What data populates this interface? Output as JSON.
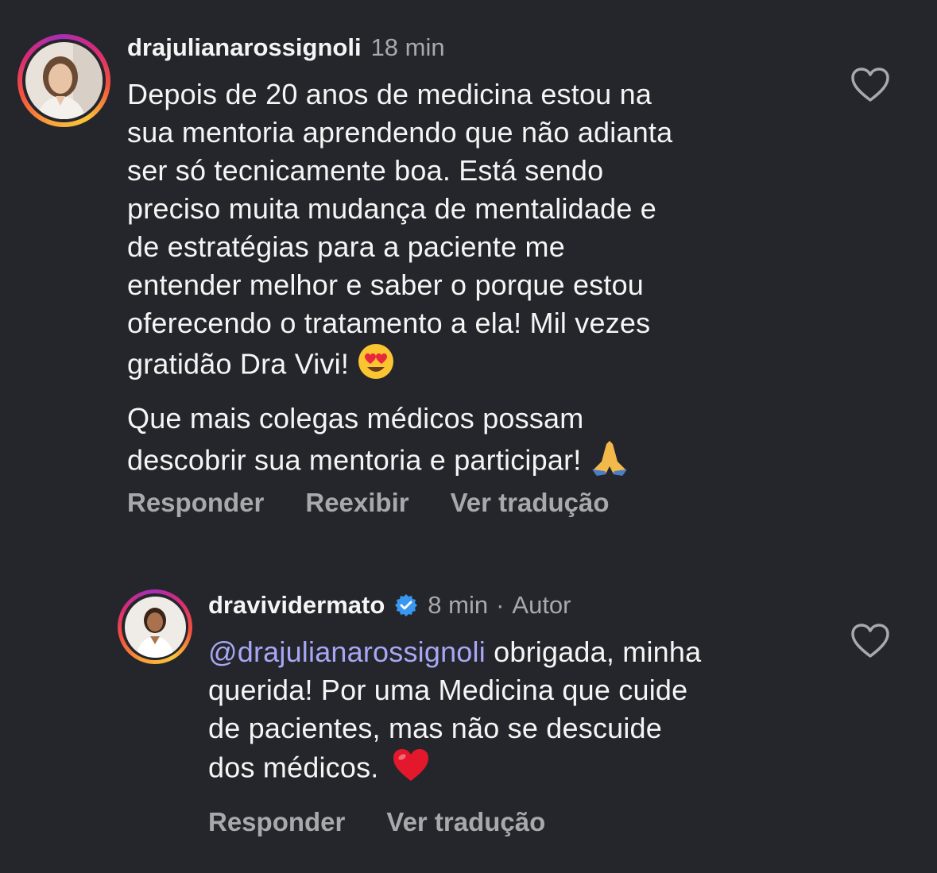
{
  "comments": [
    {
      "username": "drajulianarossignoli",
      "time": "18 min",
      "text_lines": [
        "Depois de 20 anos de medicina estou na",
        "sua mentoria aprendendo que não adianta",
        "ser só tecnicamente boa. Está sendo",
        "preciso muita mudança de mentalidade e",
        "de estratégias para a  paciente me",
        "entender melhor e saber o porque estou",
        "oferecendo o tratamento a ela! Mil vezes",
        "gratidão Dra Vivi!"
      ],
      "text_lines_2": [
        "Que mais colegas médicos possam",
        "descobrir sua mentoria e participar!"
      ],
      "actions": {
        "reply": "Responder",
        "show": "Reexibir",
        "translate": "Ver tradução"
      }
    },
    {
      "username": "dravividermato",
      "time": "8 min",
      "separator": "·",
      "author_label": "Autor",
      "mention": "@drajulianarossignoli",
      "text_first_rest": " obrigada, minha",
      "text_lines": [
        "querida! Por uma Medicina que cuide",
        "de pacientes, mas não se descuide",
        "dos médicos."
      ],
      "actions": {
        "reply": "Responder",
        "translate": "Ver tradução"
      }
    }
  ],
  "colors": {
    "background": "#25262b",
    "text": "#f5f5f5",
    "muted": "#a8a8ad",
    "mention": "#a7a8f5",
    "verified": "#3897f0"
  },
  "icons": [
    "heart-outline-icon",
    "verified-badge-icon",
    "heart-eyes-emoji",
    "praying-hands-emoji",
    "red-heart-emoji"
  ]
}
